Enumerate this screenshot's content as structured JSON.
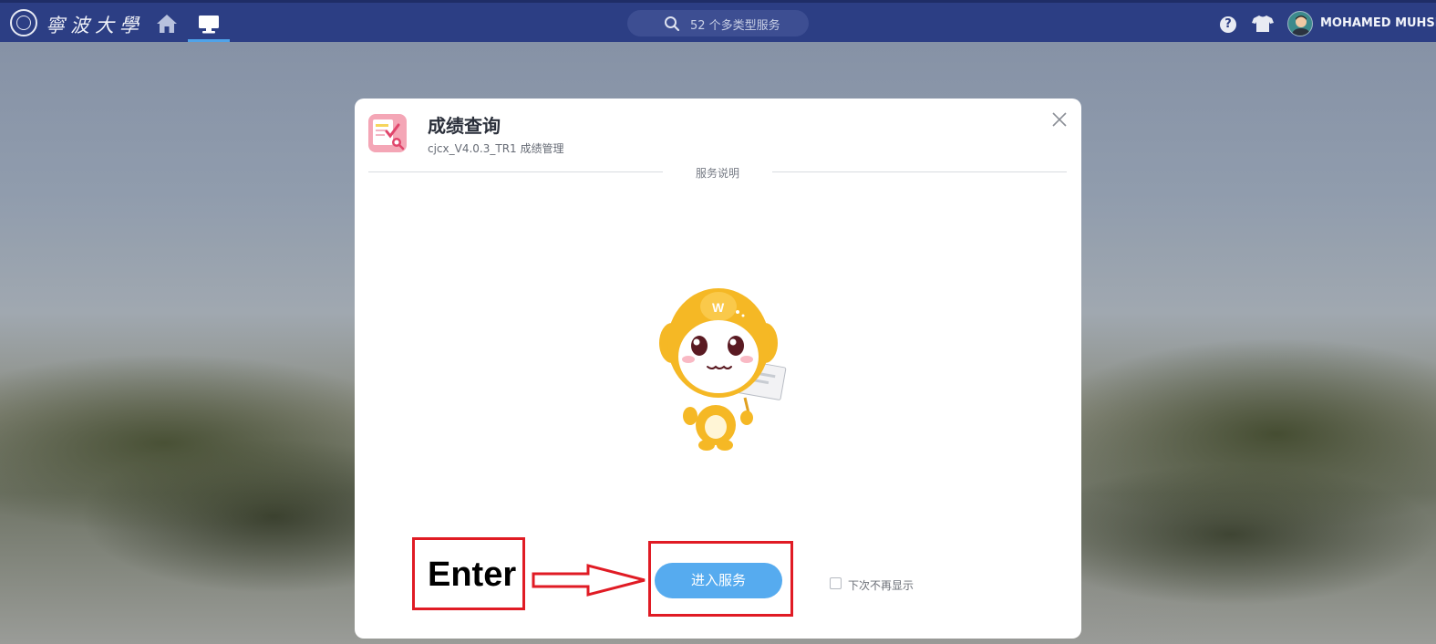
{
  "nav": {
    "logo_text": "寧波大學",
    "search_placeholder": "52 个多类型服务",
    "username": "MOHAMED MUHSIN"
  },
  "modal": {
    "title": "成绩查询",
    "subtitle": "cjcx_V4.0.3_TR1 成绩管理",
    "section_label": "服务说明",
    "enter_button": "进入服务",
    "dont_show_label": "下次不再显示",
    "dont_show_checked": false
  },
  "annotation": {
    "label": "Enter",
    "color": "#e01b24"
  },
  "colors": {
    "topbar": "#2c3e84",
    "accent": "#56abef"
  }
}
